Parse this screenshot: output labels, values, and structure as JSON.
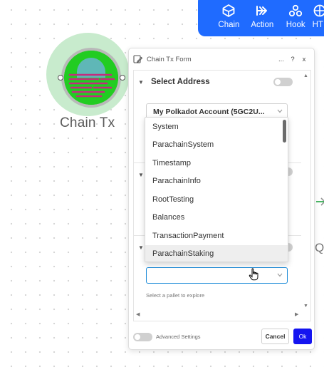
{
  "toolbar": {
    "items": [
      {
        "label": "Chain",
        "icon": "chain-icon"
      },
      {
        "label": "Action",
        "icon": "action-arrow-icon"
      },
      {
        "label": "Hook",
        "icon": "hook-icon"
      },
      {
        "label": "HT",
        "icon": "globe-icon"
      }
    ]
  },
  "canvas": {
    "node_label": "Chain Tx",
    "partial_right_text": "Q"
  },
  "form": {
    "title": "Chain Tx Form",
    "header_buttons": {
      "more": "...",
      "help": "?",
      "close": "x"
    },
    "sections": [
      {
        "title": "Select Address",
        "address_value": "My Polkadot Account (5GC2U..."
      },
      {
        "title": ""
      },
      {
        "title": "",
        "hint": "Select a pallet to explore"
      }
    ],
    "footer": {
      "advanced_label": "Advanced Settings",
      "cancel_label": "Cancel",
      "ok_label": "Ok"
    }
  },
  "dropdown": {
    "options": [
      "System",
      "ParachainSystem",
      "Timestamp",
      "ParachainInfo",
      "RootTesting",
      "Balances",
      "TransactionPayment",
      "ParachainStaking"
    ],
    "hovered_option": "ParachainStaking"
  },
  "colors": {
    "toolbar": "#1f6bff",
    "node_green": "#22cc22",
    "node_halo": "#c8ebcd",
    "ok_button": "#1414f0"
  }
}
